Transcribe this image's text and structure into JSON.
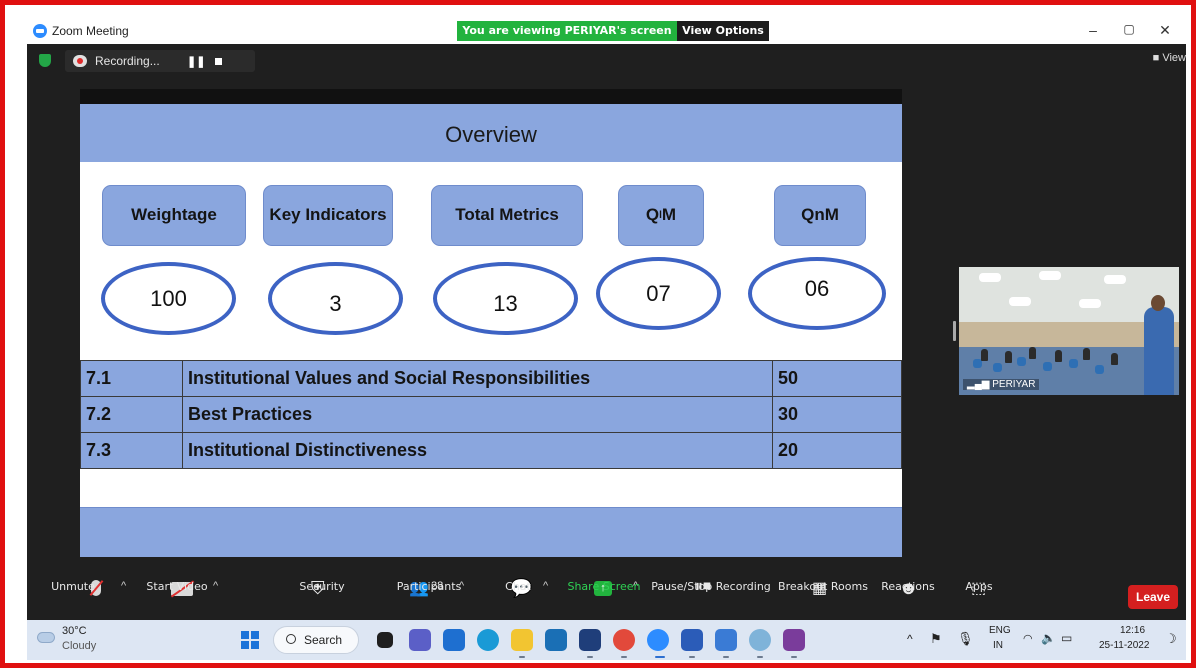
{
  "window": {
    "title": "Zoom Meeting",
    "viewing_banner": "You are viewing PERIYAR's screen",
    "view_options": "View Options ⌄",
    "minimize": "–",
    "restore": "▢",
    "close": "✕"
  },
  "recording": {
    "label": "Recording...",
    "view_right": "View"
  },
  "slide": {
    "title": "Overview",
    "pills": [
      "Weightage",
      "Key Indicators",
      "Total Metrics",
      "QlM",
      "QnM"
    ],
    "values": [
      "100",
      "3",
      "13",
      "07",
      "06"
    ],
    "rows": [
      {
        "id": "7.1",
        "name": "Institutional Values and Social Responsibilities",
        "weight": "50"
      },
      {
        "id": "7.2",
        "name": "Best Practices",
        "weight": "30"
      },
      {
        "id": "7.3",
        "name": "Institutional Distinctiveness",
        "weight": "20"
      }
    ]
  },
  "participant": {
    "name": "PERIYAR"
  },
  "toolbar": {
    "unmute": "Unmute",
    "start_video": "Start Video",
    "security": "Security",
    "participants": "Participants",
    "participants_count": "28",
    "chat": "Chat",
    "share_screen": "Share Screen",
    "pause_recording": "Pause/Stop Recording",
    "breakout_rooms": "Breakout Rooms",
    "reactions": "Reactions",
    "apps": "Apps",
    "leave": "Leave"
  },
  "taskbar": {
    "temperature": "30°C",
    "weather": "Cloudy",
    "search": "Search",
    "lang1": "ENG",
    "lang2": "IN",
    "time": "12:16",
    "date": "25-11-2022"
  },
  "colors": {
    "frame_border": "#e01010",
    "slide_accent": "#8aa6de",
    "oval_border": "#3d63c4",
    "banner_green": "#22b33e",
    "leave_red": "#d41f1f"
  }
}
